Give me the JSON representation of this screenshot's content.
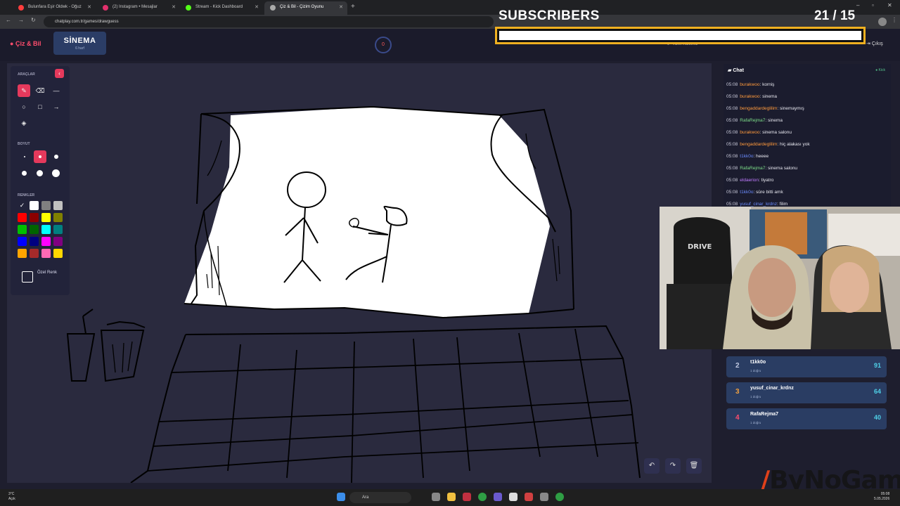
{
  "browser": {
    "tabs": [
      {
        "label": "Bulunfara Eşir Oldwk - Oğuz",
        "color": "#ff3d3d"
      },
      {
        "label": "(2) Instagram • Mesajlar",
        "color": "#e1306c"
      },
      {
        "label": "Stream - Kick Dashboard",
        "color": "#53fc18"
      },
      {
        "label": "Çiz & Bil - Çizim Oyunu",
        "color": "#aaaaaa"
      }
    ],
    "url": "chatplay.com.tr/games/drawguess"
  },
  "app": {
    "logo": "Çiz & Bil",
    "word": "SİNEMA",
    "word_sub": "6 harf",
    "timer": "0",
    "tools_label": "Yeni Kelime",
    "exit_label": "Çıkış"
  },
  "overlay": {
    "title": "SUBSCRIBERS",
    "count": "21  / 15",
    "progress": 1.0
  },
  "tools": {
    "araclar": "ARAÇLAR",
    "boyut": "BOYUT",
    "renkler": "RENKLER",
    "custom_color_label": "Özel Renk",
    "colors": [
      "#000000",
      "#ffffff",
      "#808080",
      "#c0c0c0",
      "#ff0000",
      "#8b0000",
      "#ffff00",
      "#808000",
      "#00c000",
      "#006400",
      "#00ffff",
      "#008080",
      "#0000ff",
      "#000080",
      "#ff00ff",
      "#800080",
      "#ffa500",
      "#a52a2a",
      "#ff69b4",
      "#ffd700"
    ]
  },
  "chat": {
    "title": "Chat",
    "platform": "Kick",
    "messages": [
      {
        "time": "05:08",
        "user": "burakwoo",
        "text": ": korniş",
        "color": "#ff9a3d"
      },
      {
        "time": "05:08",
        "user": "burakwoo",
        "text": ": sinema",
        "color": "#ff9a3d"
      },
      {
        "time": "05:08",
        "user": "bengaddardeglilim",
        "text": ": sinemaymış",
        "color": "#ff9a3d"
      },
      {
        "time": "05:08",
        "user": "RafaRejma7",
        "text": ": sinema",
        "color": "#7ee08a"
      },
      {
        "time": "05:08",
        "user": "burakwoo",
        "text": ": sinema salonu",
        "color": "#ff9a3d"
      },
      {
        "time": "05:08",
        "user": "bengaddardeglilim",
        "text": ": hiç alakası yok",
        "color": "#ff9a3d"
      },
      {
        "time": "05:08",
        "user": "t1kk0o",
        "text": ": heeee",
        "color": "#6b8cff"
      },
      {
        "time": "05:08",
        "user": "RafaRejma7",
        "text": ": sinema salonu",
        "color": "#7ee08a"
      },
      {
        "time": "05:08",
        "user": "eldaerion",
        "text": ": tiyatro",
        "color": "#c07bff"
      },
      {
        "time": "05:08",
        "user": "t1kk0o",
        "text": ": süre bitti amk",
        "color": "#6b8cff"
      },
      {
        "time": "05:08",
        "user": "yusuf_cinar_krdnz",
        "text": ": filim",
        "color": "#6b8cff"
      }
    ]
  },
  "leaderboard": [
    {
      "rank": "2",
      "name": "t1kk0o",
      "sub": "1 doğru",
      "score": "91",
      "rank_color": "#c0c8e0"
    },
    {
      "rank": "3",
      "name": "yusuf_cinar_krdnz",
      "sub": "1 doğru",
      "score": "64",
      "rank_color": "#f0a040"
    },
    {
      "rank": "4",
      "name": "RafaRejma7",
      "sub": "1 doğru",
      "score": "40",
      "rank_color": "#ff4d6d"
    }
  ],
  "watermark": "ByNoGame",
  "taskbar": {
    "weather_temp": "3°C",
    "weather_desc": "Açık",
    "search": "Ara",
    "time": "05:08",
    "date": "5.05.2026"
  }
}
